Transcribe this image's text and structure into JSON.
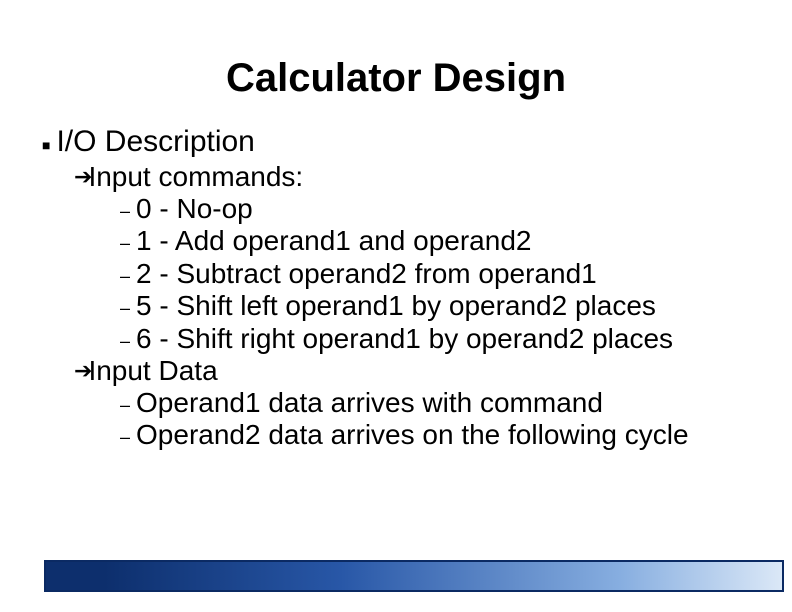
{
  "title": "Calculator Design",
  "section": "I/O Description",
  "group1": {
    "heading": "Input commands:"
  },
  "cmd0": "0 - No-op",
  "cmd1": "1 - Add operand1 and operand2",
  "cmd2": "2 - Subtract operand2 from operand1",
  "cmd5": "5 - Shift left operand1 by operand2 places",
  "cmd6": "6 - Shift right operand1 by operand2 places",
  "group2": {
    "heading": "Input Data"
  },
  "data1": "Operand1 data arrives with command",
  "data2": "Operand2 data arrives on the following cycle"
}
